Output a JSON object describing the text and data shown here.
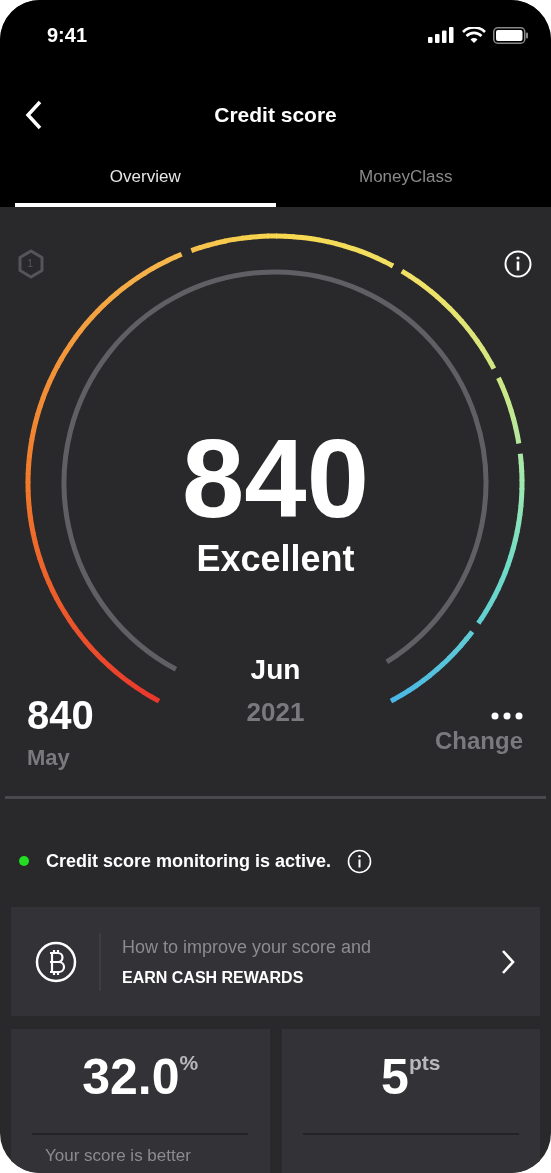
{
  "status_bar": {
    "time": "9:41"
  },
  "header": {
    "title": "Credit score"
  },
  "tabs": [
    {
      "label": "Overview",
      "selected": true
    },
    {
      "label": "MoneyClass",
      "selected": false
    }
  ],
  "gauge": {
    "badge": "1",
    "score": "840",
    "rating": "Excellent",
    "month": "Jun",
    "year": "2021"
  },
  "previous": {
    "score": "840",
    "month": "May"
  },
  "change": {
    "label": "Change"
  },
  "monitoring": {
    "active": true,
    "text": "Credit score monitoring is active."
  },
  "promo": {
    "line_1": "How to improve your score and",
    "line_2": "EARN CASH REWARDS"
  },
  "stats": [
    {
      "value": "32.0",
      "unit": "%",
      "caption": "Your score is better"
    },
    {
      "value": "5",
      "unit": "pts"
    }
  ]
}
